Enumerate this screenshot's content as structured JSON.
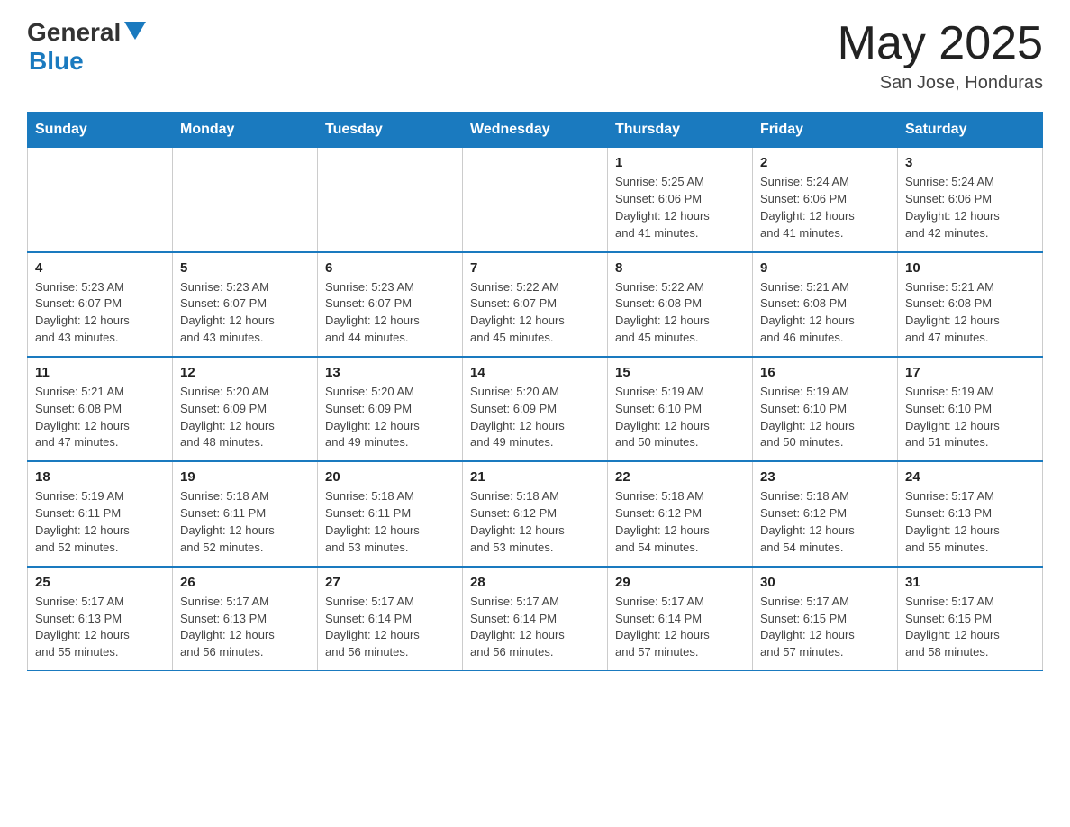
{
  "header": {
    "logo_general": "General",
    "logo_blue": "Blue",
    "month_title": "May 2025",
    "location": "San Jose, Honduras"
  },
  "days_of_week": [
    "Sunday",
    "Monday",
    "Tuesday",
    "Wednesday",
    "Thursday",
    "Friday",
    "Saturday"
  ],
  "weeks": [
    [
      {
        "day": "",
        "info": ""
      },
      {
        "day": "",
        "info": ""
      },
      {
        "day": "",
        "info": ""
      },
      {
        "day": "",
        "info": ""
      },
      {
        "day": "1",
        "info": "Sunrise: 5:25 AM\nSunset: 6:06 PM\nDaylight: 12 hours\nand 41 minutes."
      },
      {
        "day": "2",
        "info": "Sunrise: 5:24 AM\nSunset: 6:06 PM\nDaylight: 12 hours\nand 41 minutes."
      },
      {
        "day": "3",
        "info": "Sunrise: 5:24 AM\nSunset: 6:06 PM\nDaylight: 12 hours\nand 42 minutes."
      }
    ],
    [
      {
        "day": "4",
        "info": "Sunrise: 5:23 AM\nSunset: 6:07 PM\nDaylight: 12 hours\nand 43 minutes."
      },
      {
        "day": "5",
        "info": "Sunrise: 5:23 AM\nSunset: 6:07 PM\nDaylight: 12 hours\nand 43 minutes."
      },
      {
        "day": "6",
        "info": "Sunrise: 5:23 AM\nSunset: 6:07 PM\nDaylight: 12 hours\nand 44 minutes."
      },
      {
        "day": "7",
        "info": "Sunrise: 5:22 AM\nSunset: 6:07 PM\nDaylight: 12 hours\nand 45 minutes."
      },
      {
        "day": "8",
        "info": "Sunrise: 5:22 AM\nSunset: 6:08 PM\nDaylight: 12 hours\nand 45 minutes."
      },
      {
        "day": "9",
        "info": "Sunrise: 5:21 AM\nSunset: 6:08 PM\nDaylight: 12 hours\nand 46 minutes."
      },
      {
        "day": "10",
        "info": "Sunrise: 5:21 AM\nSunset: 6:08 PM\nDaylight: 12 hours\nand 47 minutes."
      }
    ],
    [
      {
        "day": "11",
        "info": "Sunrise: 5:21 AM\nSunset: 6:08 PM\nDaylight: 12 hours\nand 47 minutes."
      },
      {
        "day": "12",
        "info": "Sunrise: 5:20 AM\nSunset: 6:09 PM\nDaylight: 12 hours\nand 48 minutes."
      },
      {
        "day": "13",
        "info": "Sunrise: 5:20 AM\nSunset: 6:09 PM\nDaylight: 12 hours\nand 49 minutes."
      },
      {
        "day": "14",
        "info": "Sunrise: 5:20 AM\nSunset: 6:09 PM\nDaylight: 12 hours\nand 49 minutes."
      },
      {
        "day": "15",
        "info": "Sunrise: 5:19 AM\nSunset: 6:10 PM\nDaylight: 12 hours\nand 50 minutes."
      },
      {
        "day": "16",
        "info": "Sunrise: 5:19 AM\nSunset: 6:10 PM\nDaylight: 12 hours\nand 50 minutes."
      },
      {
        "day": "17",
        "info": "Sunrise: 5:19 AM\nSunset: 6:10 PM\nDaylight: 12 hours\nand 51 minutes."
      }
    ],
    [
      {
        "day": "18",
        "info": "Sunrise: 5:19 AM\nSunset: 6:11 PM\nDaylight: 12 hours\nand 52 minutes."
      },
      {
        "day": "19",
        "info": "Sunrise: 5:18 AM\nSunset: 6:11 PM\nDaylight: 12 hours\nand 52 minutes."
      },
      {
        "day": "20",
        "info": "Sunrise: 5:18 AM\nSunset: 6:11 PM\nDaylight: 12 hours\nand 53 minutes."
      },
      {
        "day": "21",
        "info": "Sunrise: 5:18 AM\nSunset: 6:12 PM\nDaylight: 12 hours\nand 53 minutes."
      },
      {
        "day": "22",
        "info": "Sunrise: 5:18 AM\nSunset: 6:12 PM\nDaylight: 12 hours\nand 54 minutes."
      },
      {
        "day": "23",
        "info": "Sunrise: 5:18 AM\nSunset: 6:12 PM\nDaylight: 12 hours\nand 54 minutes."
      },
      {
        "day": "24",
        "info": "Sunrise: 5:17 AM\nSunset: 6:13 PM\nDaylight: 12 hours\nand 55 minutes."
      }
    ],
    [
      {
        "day": "25",
        "info": "Sunrise: 5:17 AM\nSunset: 6:13 PM\nDaylight: 12 hours\nand 55 minutes."
      },
      {
        "day": "26",
        "info": "Sunrise: 5:17 AM\nSunset: 6:13 PM\nDaylight: 12 hours\nand 56 minutes."
      },
      {
        "day": "27",
        "info": "Sunrise: 5:17 AM\nSunset: 6:14 PM\nDaylight: 12 hours\nand 56 minutes."
      },
      {
        "day": "28",
        "info": "Sunrise: 5:17 AM\nSunset: 6:14 PM\nDaylight: 12 hours\nand 56 minutes."
      },
      {
        "day": "29",
        "info": "Sunrise: 5:17 AM\nSunset: 6:14 PM\nDaylight: 12 hours\nand 57 minutes."
      },
      {
        "day": "30",
        "info": "Sunrise: 5:17 AM\nSunset: 6:15 PM\nDaylight: 12 hours\nand 57 minutes."
      },
      {
        "day": "31",
        "info": "Sunrise: 5:17 AM\nSunset: 6:15 PM\nDaylight: 12 hours\nand 58 minutes."
      }
    ]
  ]
}
